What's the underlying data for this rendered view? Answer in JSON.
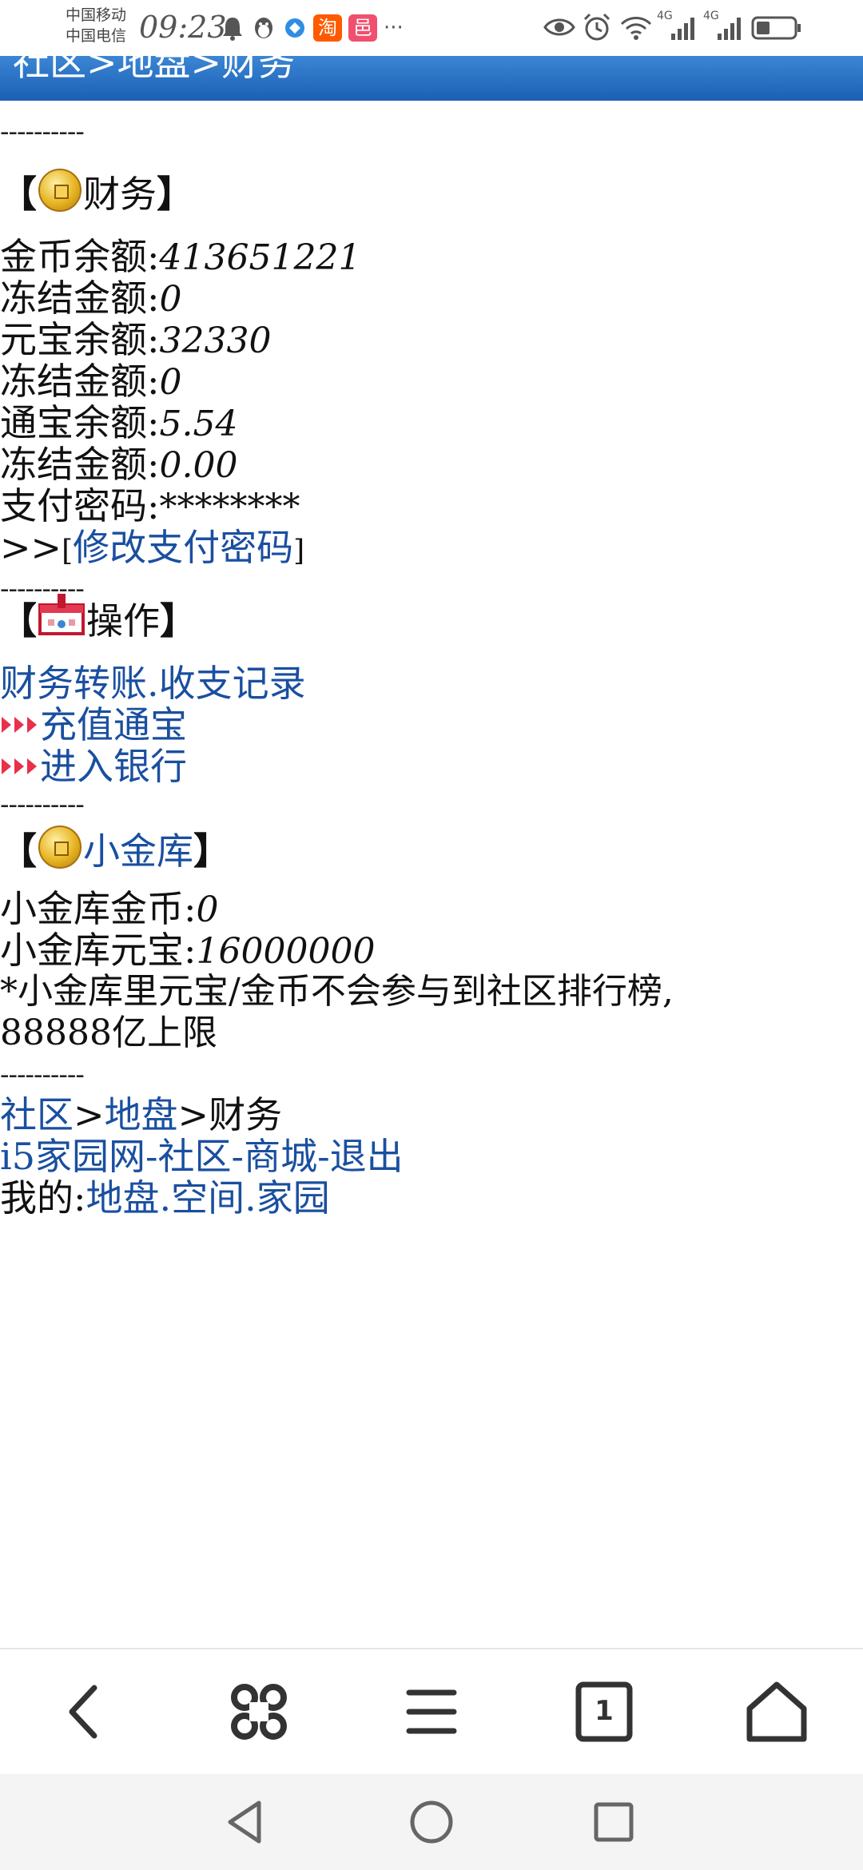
{
  "status_bar": {
    "carrier_1": "中国移动",
    "carrier_2": "中国电信",
    "time": "09:23",
    "more_dots": "···",
    "signal_1_label": "4G",
    "signal_2_label": "4G",
    "taobao_label": "淘",
    "app2_label": "邑"
  },
  "header": {
    "breadcrumb": "社区>地盘>财务"
  },
  "separator": "----------",
  "finance": {
    "bracket_open": "【",
    "bracket_close": "】",
    "title": "财务",
    "rows": [
      {
        "label": "金币余额:",
        "value": "413651221"
      },
      {
        "label": "冻结金额:",
        "value": "0"
      },
      {
        "label": "元宝余额:",
        "value": "32330"
      },
      {
        "label": "冻结金额:",
        "value": "0"
      },
      {
        "label": "通宝余额:",
        "value": "5.54"
      },
      {
        "label": "冻结金额:",
        "value": "0.00"
      },
      {
        "label": "支付密码:",
        "value": "********"
      }
    ],
    "change_prefix": ">>",
    "change_open": "[",
    "change_link": "修改支付密码",
    "change_close": "]"
  },
  "operations": {
    "title": "操作",
    "transfer_link": "财务转账",
    "dot": ".",
    "records_link": "收支记录",
    "recharge_link": "充值通宝",
    "bank_link": "进入银行"
  },
  "vault": {
    "title": "小金库",
    "gold_label": "小金库金币:",
    "gold_value": "0",
    "yuanbao_label": "小金库元宝:",
    "yuanbao_value": "16000000",
    "note_line1": "*小金库里元宝/金币不会参与到社区排行榜,",
    "note_line2": "88888亿上限"
  },
  "footer": {
    "crumb_community": "社区",
    "crumb_sep1": ">",
    "crumb_territory": "地盘",
    "crumb_sep2": ">",
    "crumb_finance": "财务",
    "site_link": "i5家园网",
    "dash1": "-",
    "community_link": "社区",
    "dash2": "-",
    "mall_link": "商城",
    "dash3": "-",
    "logout_link": "退出",
    "mine_label": "我的:",
    "territory_link": "地盘",
    "dot1": ".",
    "space_link": "空间",
    "dot2": ".",
    "home_link": "家园"
  },
  "toolbar": {
    "tabs_count": "1"
  },
  "colors": {
    "link": "#1a4fa0",
    "header_blue": "#2a72c6",
    "arrow_red": "#e8304a"
  }
}
